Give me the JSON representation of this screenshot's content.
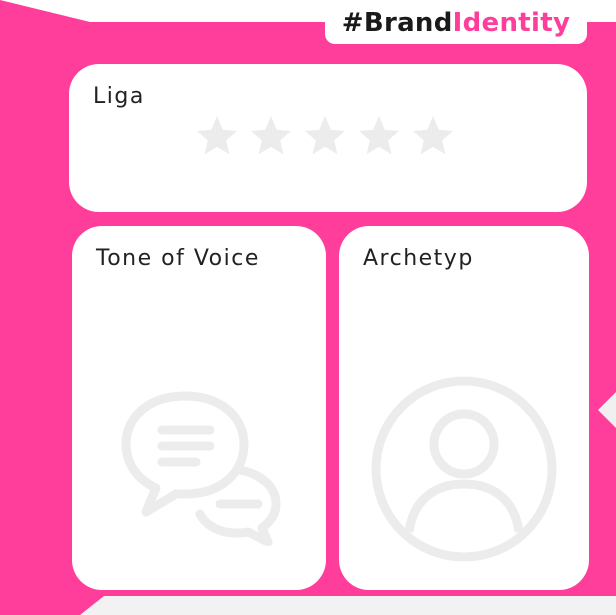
{
  "colors": {
    "accent": "#ff3d9a",
    "card_background": "#ffffff",
    "icon_gray": "#ececec",
    "text_dark": "#222222"
  },
  "header": {
    "tag_part1": "#Brand",
    "tag_part2": "Identity"
  },
  "cards": {
    "liga": {
      "title": "Liga",
      "icon": "star-icon",
      "stars_total": 5
    },
    "tone_of_voice": {
      "title": "Tone of Voice",
      "icon": "chat-bubbles-icon"
    },
    "archetyp": {
      "title": "Archetyp",
      "icon": "user-avatar-icon"
    }
  }
}
